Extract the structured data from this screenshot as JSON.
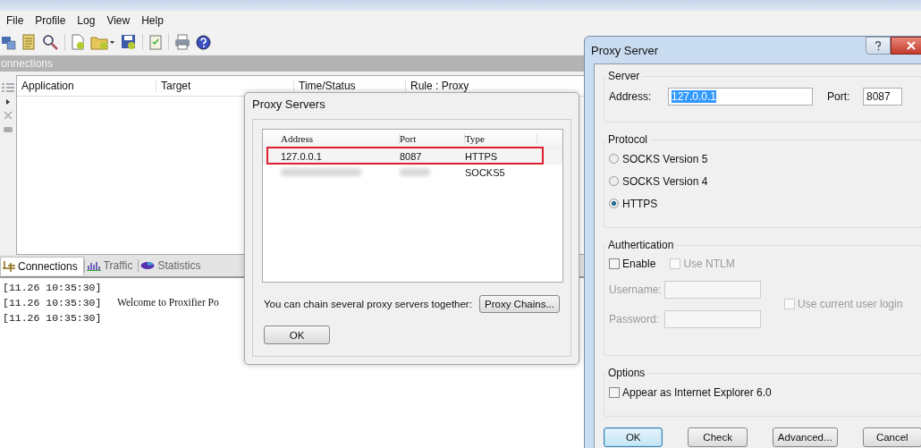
{
  "main_window": {
    "menu": [
      "File",
      "Profile",
      "Log",
      "View",
      "Help"
    ],
    "panel_title": "onnections",
    "columns": [
      "Application",
      "Target",
      "Time/Status",
      "Rule : Proxy"
    ],
    "tabs": [
      {
        "label": "Connections",
        "selected": true,
        "kind": "connections"
      },
      {
        "label": "Traffic",
        "selected": false,
        "kind": "traffic"
      },
      {
        "label": "Statistics",
        "selected": false,
        "kind": "statistics"
      }
    ],
    "log": [
      {
        "time": "[11.26 10:35:30]"
      },
      {
        "time": "[11.26 10:35:30]",
        "message": "Welcome to Proxifier Po"
      },
      {
        "time": "[11.26 10:35:30]"
      }
    ]
  },
  "proxy_servers_dialog": {
    "title": "Proxy Servers",
    "columns": [
      "Address",
      "Port",
      "Type"
    ],
    "rows": [
      {
        "address": "127.0.0.1",
        "port": "8087",
        "type": "HTTPS",
        "highlighted": true,
        "redacted": false
      },
      {
        "type": "SOCKS5",
        "highlighted": false,
        "redacted": true
      }
    ],
    "chain_text": "You can chain several proxy servers together:",
    "chain_button": "Proxy Chains...",
    "ok_button": "OK"
  },
  "proxy_server_dialog": {
    "title": "Proxy Server",
    "server": {
      "label": "Server",
      "address_label": "Address:",
      "address_value": "127.0.0.1",
      "address_selected": true,
      "port_label": "Port:",
      "port_value": "8087"
    },
    "protocol": {
      "label": "Protocol",
      "options": [
        {
          "label": "SOCKS Version 5",
          "selected": false
        },
        {
          "label": "SOCKS Version 4",
          "selected": false
        },
        {
          "label": "HTTPS",
          "selected": true
        }
      ]
    },
    "authentication": {
      "label": "Authertication",
      "enable": {
        "label": "Enable",
        "checked": false,
        "disabled": false
      },
      "ntlm": {
        "label": "Use NTLM",
        "checked": false,
        "disabled": true
      },
      "username_label": "Username:",
      "password_label": "Password:",
      "fields_disabled": true,
      "current_user": {
        "label": "Use current user login",
        "checked": false,
        "disabled": true
      }
    },
    "options": {
      "label": "Options",
      "items": [
        {
          "label": "Appear as Internet Explorer 6.0",
          "checked": false
        }
      ]
    },
    "buttons": [
      {
        "label": "OK",
        "default": true
      },
      {
        "label": "Check",
        "default": false
      },
      {
        "label": "Advanced...",
        "default": false
      },
      {
        "label": "Cancel",
        "default": false
      }
    ]
  }
}
